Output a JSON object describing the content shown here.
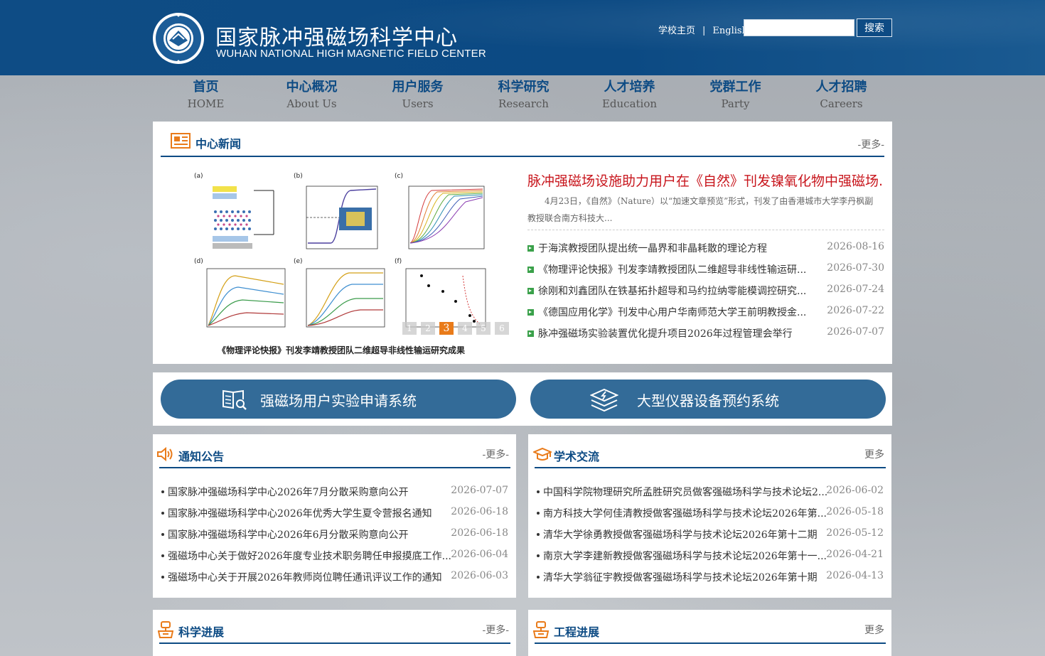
{
  "header": {
    "title_cn": "国家脉冲强磁场科学中心",
    "title_en": "WUHAN NATIONAL HIGH MAGNETIC FIELD CENTER",
    "links": [
      "学校主页",
      "English"
    ],
    "separator": "|",
    "search": {
      "value": "",
      "button": "搜索"
    }
  },
  "nav": [
    {
      "cn": "首页",
      "en": "HOME"
    },
    {
      "cn": "中心概况",
      "en": "About Us"
    },
    {
      "cn": "用户服务",
      "en": "Users"
    },
    {
      "cn": "科学研究",
      "en": "Research"
    },
    {
      "cn": "人才培养",
      "en": "Education"
    },
    {
      "cn": "党群工作",
      "en": "Party"
    },
    {
      "cn": "人才招聘",
      "en": "Careers"
    }
  ],
  "center_news": {
    "title": "中心新闻",
    "more": "-更多-",
    "slider": {
      "caption": "《物理评论快报》刊发李靖教授团队二维超导非线性输运研究成果",
      "dots": [
        "1",
        "2",
        "3",
        "4",
        "5",
        "6"
      ],
      "active_dot": 3
    },
    "lead": {
      "title": "脉冲强磁场设施助力用户在《自然》刊发镍氧化物中强磁场...",
      "summary": "4月23日，《自然》（Nature）以“加速文章预览”形式，刊发了由香港城市大学李丹枫副教授联合南方科技大..."
    },
    "items": [
      {
        "title": "于海滨教授团队提出统一晶界和非晶耗散的理论方程",
        "date": "2026-08-16"
      },
      {
        "title": "《物理评论快报》刊发李靖教授团队二维超导非线性输运研...",
        "date": "2026-07-30"
      },
      {
        "title": "徐刚和刘鑫团队在铁基拓扑超导和马约拉纳零能模调控研究...",
        "date": "2026-07-24"
      },
      {
        "title": "《德国应用化学》刊发中心用户华南师范大学王前明教授金...",
        "date": "2026-07-22"
      },
      {
        "title": "脉冲强磁场实验装置优化提升项目2026年过程管理会举行",
        "date": "2026-07-07"
      }
    ]
  },
  "systems": {
    "user_exp": "强磁场用户实验申请系统",
    "instrument": "大型仪器设备预约系统"
  },
  "notices": {
    "title": "通知公告",
    "more": "-更多-",
    "items": [
      {
        "title": "国家脉冲强磁场科学中心2026年7月分散采购意向公开",
        "date": "2026-07-07"
      },
      {
        "title": "国家脉冲强磁场科学中心2026年优秀大学生夏令营报名通知",
        "date": "2026-06-18"
      },
      {
        "title": "国家脉冲强磁场科学中心2026年6月分散采购意向公开",
        "date": "2026-06-18"
      },
      {
        "title": "强磁场中心关于做好2026年度专业技术职务聘任申报摸底工作...",
        "date": "2026-06-04"
      },
      {
        "title": "强磁场中心关于开展2026年教师岗位聘任通讯评议工作的通知",
        "date": "2026-06-03"
      }
    ]
  },
  "academic": {
    "title": "学术交流",
    "more": "更多",
    "items": [
      {
        "title": "中国科学院物理研究所孟胜研究员做客强磁场科学与技术论坛2...",
        "date": "2026-06-02"
      },
      {
        "title": "南方科技大学何佳清教授做客强磁场科学与技术论坛2026年第...",
        "date": "2026-05-18"
      },
      {
        "title": "清华大学徐勇教授做客强磁场科学与技术论坛2026年第十二期",
        "date": "2026-05-12"
      },
      {
        "title": "南京大学李建新教授做客强磁场科学与技术论坛2026年第十一...",
        "date": "2026-04-21"
      },
      {
        "title": "清华大学翁征宇教授做客强磁场科学与技术论坛2026年第十期",
        "date": "2026-04-13"
      }
    ]
  },
  "science_progress": {
    "title": "科学进展",
    "more": "-更多-"
  },
  "engineering_progress": {
    "title": "工程进展",
    "more": "更多"
  },
  "colors": {
    "primary": "#0d4b84",
    "headline": "#c8161d",
    "active_dot": "#e97b1a",
    "bullet": "#3aa14a",
    "system_button": "#336b98"
  },
  "icons": [
    "emblem-logo",
    "newspaper-icon",
    "speaker-icon",
    "graduation-cap-icon",
    "book-search-icon",
    "layers-lightning-icon",
    "instrument-icon"
  ]
}
